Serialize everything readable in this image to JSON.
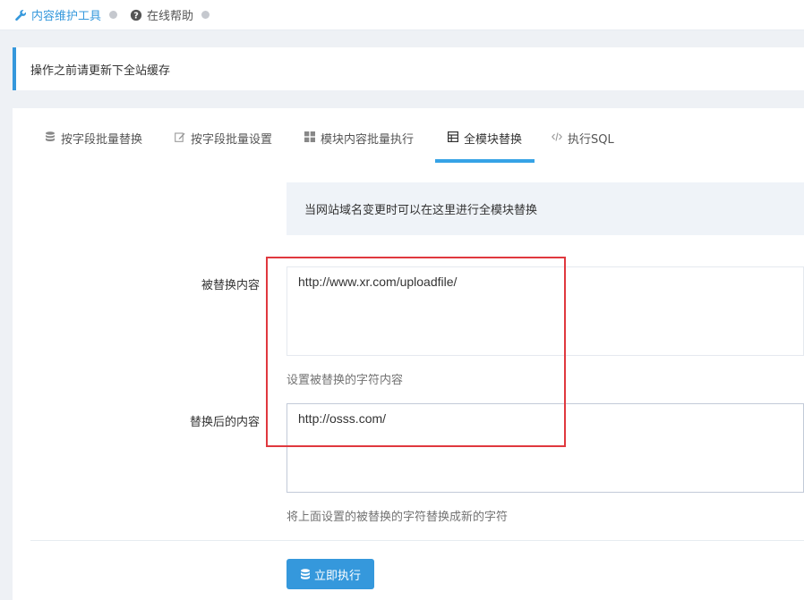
{
  "breadcrumb": {
    "item1": {
      "label": "内容维护工具",
      "icon": "wrench-icon"
    },
    "item2": {
      "label": "在线帮助",
      "icon": "question-circle-icon"
    }
  },
  "notice": {
    "text": "操作之前请更新下全站缓存"
  },
  "tabs": [
    {
      "label": "按字段批量替换",
      "icon": "database-icon",
      "active": false
    },
    {
      "label": "按字段批量设置",
      "icon": "edit-icon",
      "active": false
    },
    {
      "label": "模块内容批量执行",
      "icon": "grid-icon",
      "active": false
    },
    {
      "label": "全模块替换",
      "icon": "table-icon",
      "active": true
    },
    {
      "label": "执行SQL",
      "icon": "code-icon",
      "active": false
    }
  ],
  "info": {
    "text": "当网站域名变更时可以在这里进行全模块替换"
  },
  "form": {
    "replaced_label": "被替换内容",
    "replaced_value": "http://www.xr.com/uploadfile/",
    "replaced_help": "设置被替换的字符内容",
    "replacement_label": "替换后的内容",
    "replacement_value": "http://osss.com/",
    "replacement_help": "将上面设置的被替换的字符替换成新的字符"
  },
  "submit": {
    "label": "立即执行",
    "icon": "database-icon"
  },
  "colors": {
    "accent": "#3598dc",
    "highlight_box": "#e0383e"
  }
}
